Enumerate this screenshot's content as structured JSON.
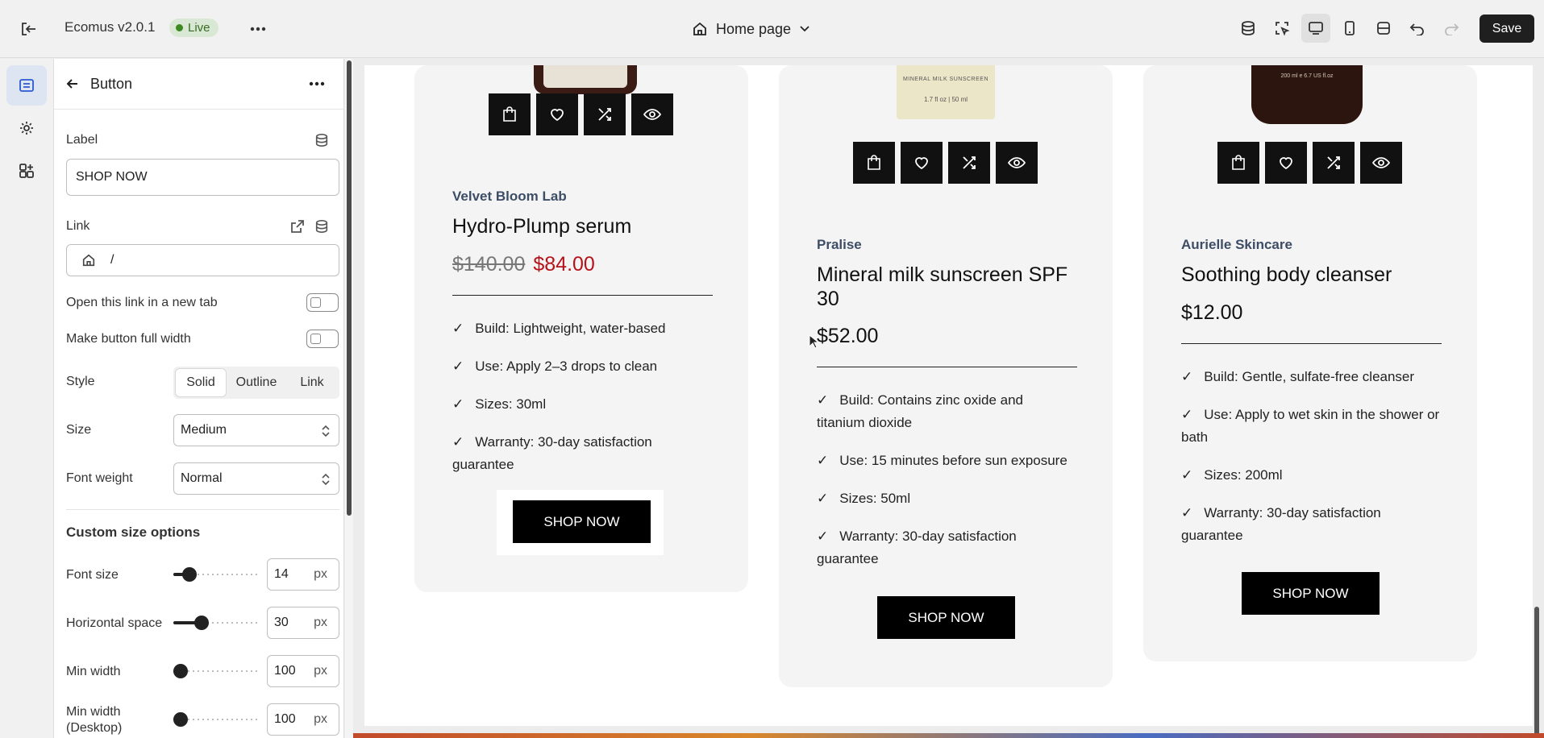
{
  "topbar": {
    "app_title": "Ecomus v2.0.1",
    "live_label": "Live",
    "page_selector": "Home page",
    "save_label": "Save"
  },
  "panel": {
    "title": "Button",
    "label_field_label": "Label",
    "label_value": "SHOP NOW",
    "link_field_label": "Link",
    "link_value": "/",
    "new_tab_label": "Open this link in a new tab",
    "full_width_label": "Make button full width",
    "style_label": "Style",
    "style_options": [
      "Solid",
      "Outline",
      "Link"
    ],
    "style_selected": "Solid",
    "size_label": "Size",
    "size_value": "Medium",
    "font_weight_label": "Font weight",
    "font_weight_value": "Normal",
    "custom_section_title": "Custom size options",
    "sliders": [
      {
        "label": "Font size",
        "value": "14",
        "unit": "px",
        "fraction": 0.12
      },
      {
        "label": "Horizontal space",
        "value": "30",
        "unit": "px",
        "fraction": 0.3
      },
      {
        "label": "Min width",
        "value": "100",
        "unit": "px",
        "fraction": 0.0
      },
      {
        "label": "Min width (Desktop)",
        "value": "100",
        "unit": "px",
        "fraction": 0.0
      }
    ]
  },
  "products": [
    {
      "vendor": "Velvet Bloom Lab",
      "name": "Hydro-Plump serum",
      "compare_price": "$140.00",
      "price": "$84.00",
      "features": [
        "Build: Lightweight, water-based",
        "Use: Apply 2–3 drops to clean",
        "Sizes: 30ml",
        "Warranty: 30-day satisfaction guarantee"
      ],
      "button": "SHOP NOW"
    },
    {
      "vendor": "Pralise",
      "name": "Mineral milk sunscreen SPF 30",
      "price": "$52.00",
      "bottle_label_top": "MINERAL MILK SUNSCREEN",
      "bottle_label_bottom": "1.7 fl oz | 50 ml",
      "features": [
        "Build: Contains zinc oxide and titanium dioxide",
        "Use: 15 minutes before sun exposure",
        "Sizes: 50ml",
        "Warranty: 30-day satisfaction guarantee"
      ],
      "button": "SHOP NOW"
    },
    {
      "vendor": "Aurielle Skincare",
      "name": "Soothing body cleanser",
      "price": "$12.00",
      "bottle_label": "200 ml e 6.7 US fl.oz",
      "features": [
        "Build: Gentle, sulfate-free cleanser",
        "Use: Apply to wet skin in the shower or bath",
        "Sizes: 200ml",
        "Warranty: 30-day satisfaction guarantee"
      ],
      "button": "SHOP NOW"
    }
  ],
  "check_glyph": "✓",
  "colors": {
    "sale": "#b5121b",
    "vendor": "#3d4d66",
    "live_dot": "#3b8a21",
    "rail_active": "#2a5ad0"
  }
}
